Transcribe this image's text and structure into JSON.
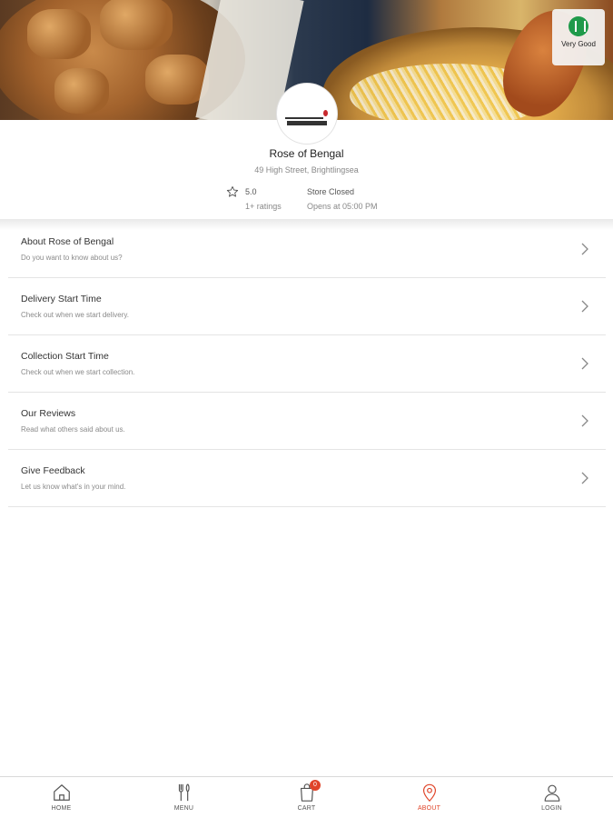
{
  "hero": {
    "rating_badge_text": "Very Good"
  },
  "store": {
    "name": "Rose of Bengal",
    "address": "49 High Street, Brightlingsea",
    "rating": "5.0",
    "rating_count": "1+ ratings",
    "status": "Store Closed",
    "opens": "Opens at 05:00 PM"
  },
  "menu": [
    {
      "title": "About Rose of Bengal",
      "subtitle": "Do you want to know about us?"
    },
    {
      "title": "Delivery Start Time",
      "subtitle": "Check out when we start delivery."
    },
    {
      "title": "Collection Start Time",
      "subtitle": "Check out when we start collection."
    },
    {
      "title": "Our Reviews",
      "subtitle": "Read what others said about us."
    },
    {
      "title": "Give Feedback",
      "subtitle": "Let us know what's in your mind."
    }
  ],
  "nav": {
    "home": "HOME",
    "menu": "MENU",
    "cart": "CART",
    "cart_count": "0",
    "about": "ABOUT",
    "login": "LOGIN"
  },
  "colors": {
    "accent": "#e0452a",
    "rating_green": "#1f9a4a"
  },
  "icons": [
    "star-icon",
    "chevron-right-icon",
    "home-icon",
    "menu-fork-knife-icon",
    "cart-bag-icon",
    "location-pin-icon",
    "user-icon",
    "rating-logo-icon"
  ]
}
